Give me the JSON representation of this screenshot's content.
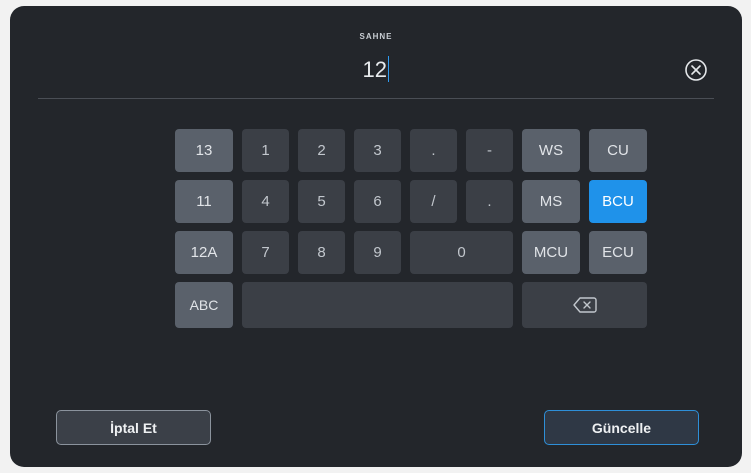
{
  "header": {
    "label": "SAHNE",
    "value": "12"
  },
  "icons": {
    "clear": "circle-x-icon",
    "backspace": "backspace-icon"
  },
  "keys": {
    "suggest": [
      "13",
      "11",
      "12A"
    ],
    "digits": [
      "1",
      "2",
      "3",
      "4",
      "5",
      "6",
      "7",
      "8",
      "9",
      "0"
    ],
    "symbols": [
      ".",
      "-",
      "/",
      "."
    ],
    "shots": [
      "WS",
      "CU",
      "MS",
      "BCU",
      "MCU",
      "ECU"
    ],
    "abc": "ABC"
  },
  "selected_shot": "BCU",
  "footer": {
    "cancel": "İptal Et",
    "update": "Güncelle"
  },
  "colors": {
    "background": "#23262b",
    "key": "#3b3f46",
    "key_highlight": "#5a616b",
    "accent": "#1f92ea"
  }
}
